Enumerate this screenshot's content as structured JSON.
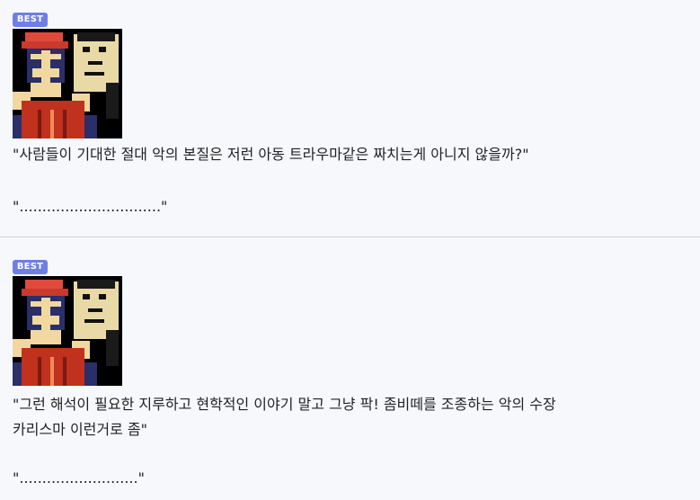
{
  "comments": [
    {
      "badge": "BEST",
      "image_alt": "pixel-art-character-image",
      "lines": [
        "\"사람들이 기대한 절대 악의 본질은 저런 아동 트라우마같은 짜치는게 아니지 않을까?\""
      ],
      "reply": "\"...............................\""
    },
    {
      "badge": "BEST",
      "image_alt": "pixel-art-character-image",
      "lines": [
        "\"그런 해석이 필요한 지루하고 현학적인 이야기 말고 그냥 팍! 좀비떼를 조종하는 악의 수장",
        "카리스마 이런거로 좀\""
      ],
      "reply": "\"..........................\""
    }
  ],
  "colors": {
    "background": "#f6f8fc",
    "badge": "#6f7fe4",
    "divider": "#cfd3da"
  }
}
